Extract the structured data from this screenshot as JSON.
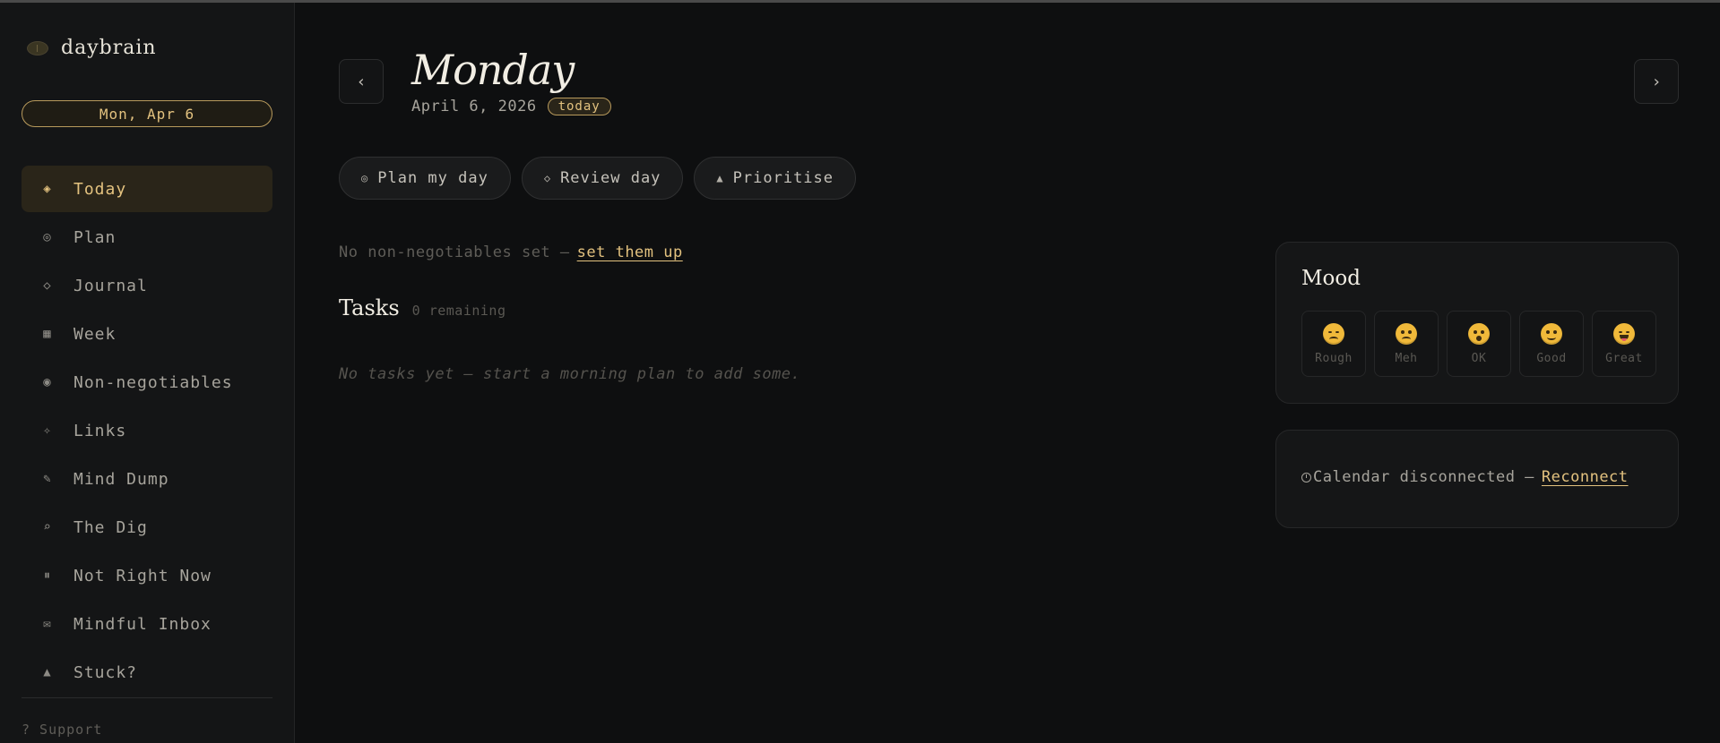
{
  "app": {
    "name": "daybrain"
  },
  "sidebar": {
    "date_pill": "Mon, Apr 6",
    "items": [
      {
        "label": "Today",
        "icon": "diamond-dot-icon",
        "glyph": "◈",
        "active": true
      },
      {
        "label": "Plan",
        "icon": "target-icon",
        "glyph": "◎",
        "active": false
      },
      {
        "label": "Journal",
        "icon": "diamond-icon",
        "glyph": "◇",
        "active": false
      },
      {
        "label": "Week",
        "icon": "grid-icon",
        "glyph": "▦",
        "active": false
      },
      {
        "label": "Non-negotiables",
        "icon": "circle-dot-icon",
        "glyph": "◉",
        "active": false
      },
      {
        "label": "Links",
        "icon": "sparkle-icon",
        "glyph": "✧",
        "active": false
      },
      {
        "label": "Mind Dump",
        "icon": "pencil-icon",
        "glyph": "✎",
        "active": false
      },
      {
        "label": "The Dig",
        "icon": "search-icon",
        "glyph": "⌕",
        "active": false
      },
      {
        "label": "Not Right Now",
        "icon": "pause-icon",
        "glyph": "⏸",
        "active": false
      },
      {
        "label": "Mindful Inbox",
        "icon": "envelope-icon",
        "glyph": "✉",
        "active": false
      },
      {
        "label": "Stuck?",
        "icon": "triangle-icon",
        "glyph": "▲",
        "active": false
      }
    ],
    "support": "? Support"
  },
  "header": {
    "prev": "‹",
    "next": "›",
    "day": "Monday",
    "date": "April 6, 2026",
    "badge": "today"
  },
  "actions": [
    {
      "label": "Plan my day",
      "icon": "target-icon",
      "glyph": "◎"
    },
    {
      "label": "Review day",
      "icon": "diamond-icon",
      "glyph": "◇"
    },
    {
      "label": "Prioritise",
      "icon": "triangle-icon",
      "glyph": "▲"
    }
  ],
  "non_negotiables": {
    "text": "No non-negotiables set —",
    "link": "set them up"
  },
  "tasks": {
    "title": "Tasks",
    "count": "0 remaining",
    "empty": "No tasks yet — start a morning plan to add some."
  },
  "mood": {
    "title": "Mood",
    "options": [
      "Rough",
      "Meh",
      "OK",
      "Good",
      "Great"
    ]
  },
  "calendar": {
    "text": "Calendar disconnected —",
    "link": "Reconnect"
  },
  "colors": {
    "accent": "#e3c27f",
    "background": "#0e0f10",
    "sidebar": "#141516"
  }
}
